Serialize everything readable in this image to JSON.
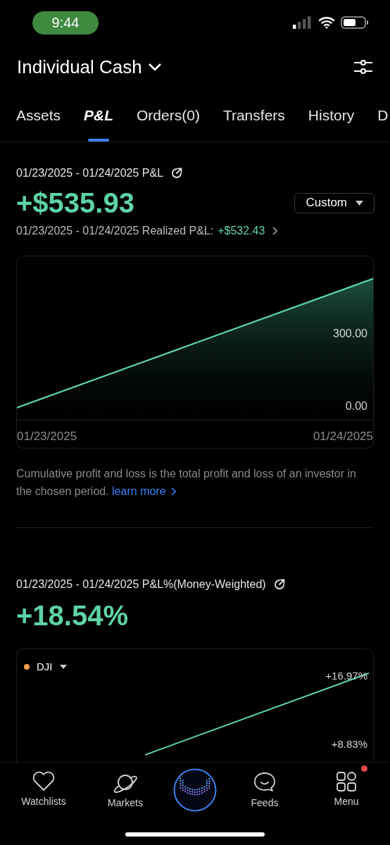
{
  "status_bar": {
    "time": "9:44"
  },
  "header": {
    "account": "Individual Cash"
  },
  "tabs": [
    {
      "label": "Assets",
      "selected": false
    },
    {
      "label": "P&L",
      "selected": true
    },
    {
      "label": "Orders(0)",
      "selected": false
    },
    {
      "label": "Transfers",
      "selected": false
    },
    {
      "label": "History",
      "selected": false
    },
    {
      "label": "D",
      "selected": false
    }
  ],
  "pnl": {
    "title": "01/23/2025 - 01/24/2025 P&L",
    "value": "+$535.93",
    "period": "Custom",
    "realized_label": "01/23/2025 - 01/24/2025 Realized P&L:",
    "realized_value": "+$532.43",
    "chart_y_labels": [
      "300.00",
      "0.00"
    ],
    "chart_x_labels": [
      "01/23/2025",
      "01/24/2025"
    ],
    "note": "Cumulative profit and loss is the total profit and loss of an investor in the chosen period.",
    "link": "learn more"
  },
  "pnl_percent": {
    "title": "01/23/2025 - 01/24/2025 P&L%(Money-Weighted)",
    "value": "+18.54%",
    "benchmark": {
      "name": "DJI",
      "color": "#f5a04a"
    },
    "axis_labels": [
      "+16.97%",
      "+8.83%"
    ]
  },
  "nav": [
    {
      "label": "Watchlists",
      "kind": "heart"
    },
    {
      "label": "Markets",
      "kind": "planet"
    },
    {
      "kind": "center"
    },
    {
      "label": "Feeds",
      "kind": "chat"
    },
    {
      "label": "Menu",
      "kind": "grid",
      "badge": true
    }
  ]
}
